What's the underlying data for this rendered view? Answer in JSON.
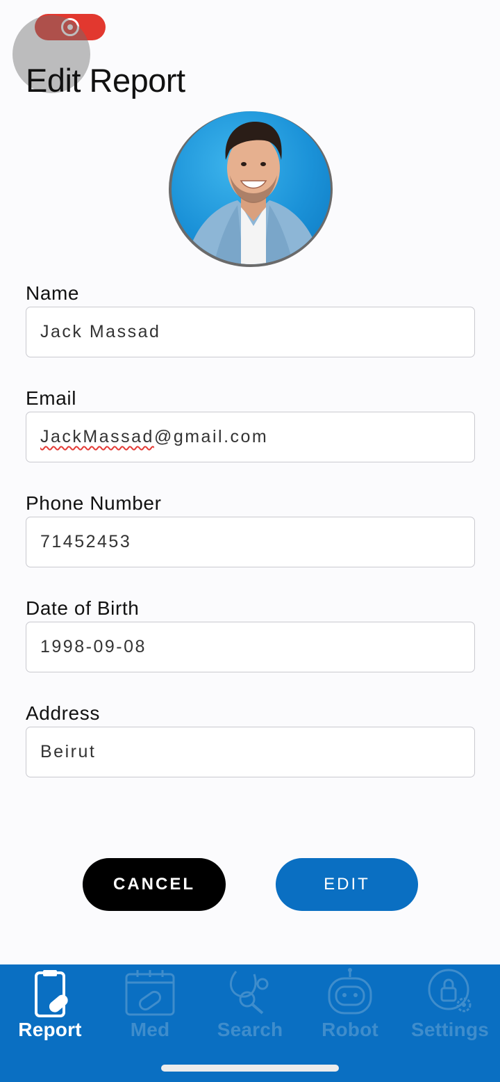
{
  "page": {
    "title": "Edit Report"
  },
  "form": {
    "fields": [
      {
        "label": "Name",
        "value": "Jack Massad"
      },
      {
        "label": "Email",
        "value": "JackMassad@gmail.com",
        "value_misspelled_part": "JackMassad",
        "value_rest": "@gmail.com"
      },
      {
        "label": "Phone Number",
        "value": "71452453"
      },
      {
        "label": "Date of Birth",
        "value": "1998-09-08"
      },
      {
        "label": "Address",
        "value": "Beirut"
      }
    ]
  },
  "actions": {
    "cancel_label": "CANCEL",
    "edit_label": "EDIT"
  },
  "tabbar": {
    "items": [
      {
        "label": "Report",
        "icon": "clipboard-icon",
        "active": true
      },
      {
        "label": "Med",
        "icon": "calendar-pill-icon",
        "active": false
      },
      {
        "label": "Search",
        "icon": "stethoscope-search-icon",
        "active": false
      },
      {
        "label": "Robot",
        "icon": "robot-icon",
        "active": false
      },
      {
        "label": "Settings",
        "icon": "lock-gear-icon",
        "active": false
      }
    ]
  },
  "colors": {
    "brand_blue": "#0a6fc2",
    "tab_inactive": "#3f8dcc",
    "recording_red": "#e2382f",
    "cancel_black": "#000000"
  }
}
